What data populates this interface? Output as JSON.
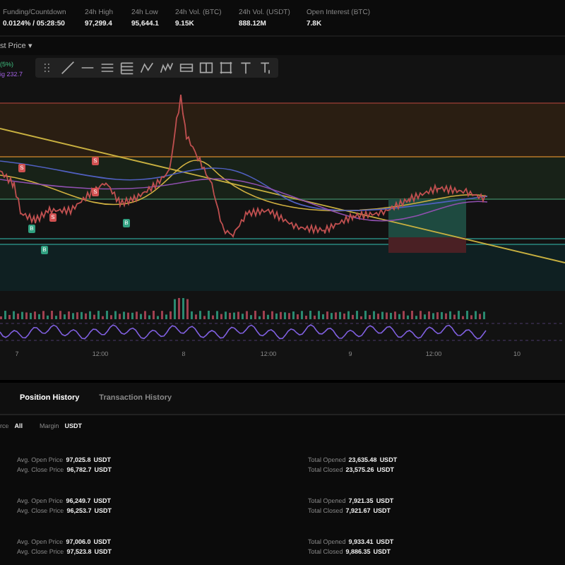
{
  "stats": [
    {
      "label": "Funding/Countdown",
      "value": "0.0124% / 05:28:50"
    },
    {
      "label": "24h High",
      "value": "97,299.4"
    },
    {
      "label": "24h Low",
      "value": "95,644.1"
    },
    {
      "label": "24h Vol. (BTC)",
      "value": "9.15K"
    },
    {
      "label": "24h Vol. (USDT)",
      "value": "888.12M"
    },
    {
      "label": "Open Interest (BTC)",
      "value": "7.8K"
    }
  ],
  "price_selector": {
    "label": "st Price",
    "caret": "▾"
  },
  "chart": {
    "legend": [
      {
        "text": "(5%)",
        "kind": "green"
      },
      {
        "text": "ig 232.7",
        "kind": "purple"
      }
    ],
    "toolbar": [
      {
        "kind": "grip"
      },
      {
        "kind": "line"
      },
      {
        "kind": "hline"
      },
      {
        "kind": "channel"
      },
      {
        "kind": "fib"
      },
      {
        "kind": "pattern"
      },
      {
        "kind": "wave"
      },
      {
        "kind": "range"
      },
      {
        "kind": "measure"
      },
      {
        "kind": "frame"
      },
      {
        "kind": "text"
      },
      {
        "kind": "text-note"
      }
    ],
    "markers": [
      {
        "kind": "sell",
        "label": "S"
      },
      {
        "kind": "sell",
        "label": "S"
      },
      {
        "kind": "sell",
        "label": "S"
      },
      {
        "kind": "sell",
        "label": "S"
      },
      {
        "kind": "buy",
        "label": "B"
      },
      {
        "kind": "buy",
        "label": "B"
      },
      {
        "kind": "buy",
        "label": "B"
      }
    ],
    "x_axis": [
      "7",
      "12:00",
      "8",
      "12:00",
      "9",
      "12:00",
      "10"
    ]
  },
  "tabs": [
    {
      "label": "Position History",
      "selected": true
    },
    {
      "label": "Transaction History",
      "selected": false
    }
  ],
  "filters": [
    {
      "label": "rce",
      "value": "All"
    },
    {
      "label": "Margin",
      "value": "USDT"
    }
  ],
  "positions": [
    {
      "left": [
        {
          "label": "Avg. Open Price",
          "value": "97,025.8",
          "unit": "USDT"
        },
        {
          "label": "Avg. Close Price",
          "value": "96,782.7",
          "unit": "USDT"
        }
      ],
      "right": [
        {
          "label": "Total Opened",
          "value": "23,635.48",
          "unit": "USDT"
        },
        {
          "label": "Total Closed",
          "value": "23,575.26",
          "unit": "USDT"
        }
      ]
    },
    {
      "left": [
        {
          "label": "Avg. Open Price",
          "value": "96,249.7",
          "unit": "USDT"
        },
        {
          "label": "Avg. Close Price",
          "value": "96,253.7",
          "unit": "USDT"
        }
      ],
      "right": [
        {
          "label": "Total Opened",
          "value": "7,921.35",
          "unit": "USDT"
        },
        {
          "label": "Total Closed",
          "value": "7,921.67",
          "unit": "USDT"
        }
      ]
    },
    {
      "left": [
        {
          "label": "Avg. Open Price",
          "value": "97,006.0",
          "unit": "USDT"
        },
        {
          "label": "Avg. Close Price",
          "value": "97,523.8",
          "unit": "USDT"
        }
      ],
      "right": [
        {
          "label": "Total Opened",
          "value": "9,933.41",
          "unit": "USDT"
        },
        {
          "label": "Total Closed",
          "value": "9,886.35",
          "unit": "USDT"
        }
      ]
    }
  ]
}
